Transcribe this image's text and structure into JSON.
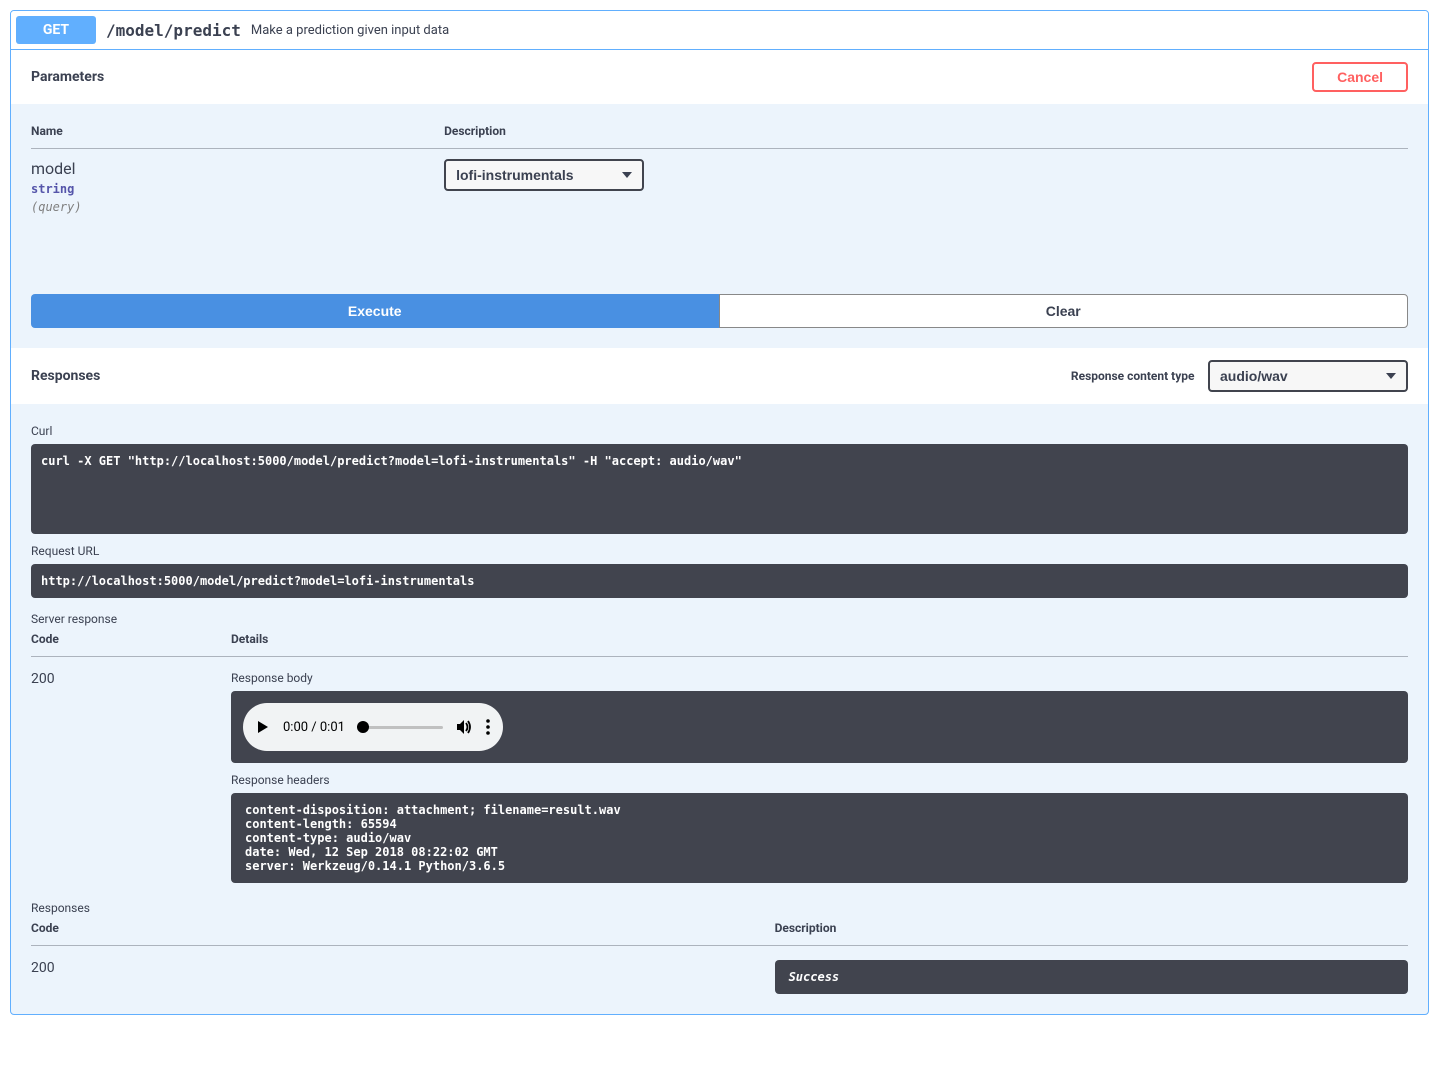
{
  "summary": {
    "method": "GET",
    "path": "/model/predict",
    "description": "Make a prediction given input data"
  },
  "parameters": {
    "heading": "Parameters",
    "cancel_label": "Cancel",
    "col_name": "Name",
    "col_desc": "Description",
    "param": {
      "name": "model",
      "type": "string",
      "location": "(query)",
      "selected": "lofi-instrumentals"
    }
  },
  "buttons": {
    "execute": "Execute",
    "clear": "Clear"
  },
  "responses": {
    "heading": "Responses",
    "content_type_label": "Response content type",
    "content_type_value": "audio/wav",
    "curl_label": "Curl",
    "curl_cmd": "curl -X GET \"http://localhost:5000/model/predict?model=lofi-instrumentals\" -H \"accept: audio/wav\"",
    "url_label": "Request URL",
    "url_value": "http://localhost:5000/model/predict?model=lofi-instrumentals",
    "server_resp_label": "Server response",
    "code_header": "Code",
    "details_header": "Details",
    "code_value": "200",
    "resp_body_label": "Response body",
    "audio": {
      "time": "0:00 / 0:01"
    },
    "resp_headers_label": "Response headers",
    "headers_text": "content-disposition: attachment; filename=result.wav\ncontent-length: 65594\ncontent-type: audio/wav\ndate: Wed, 12 Sep 2018 08:22:02 GMT\nserver: Werkzeug/0.14.1 Python/3.6.5",
    "doc_heading": "Responses",
    "doc_code_header": "Code",
    "doc_desc_header": "Description",
    "doc_code": "200",
    "doc_desc": "Success"
  }
}
